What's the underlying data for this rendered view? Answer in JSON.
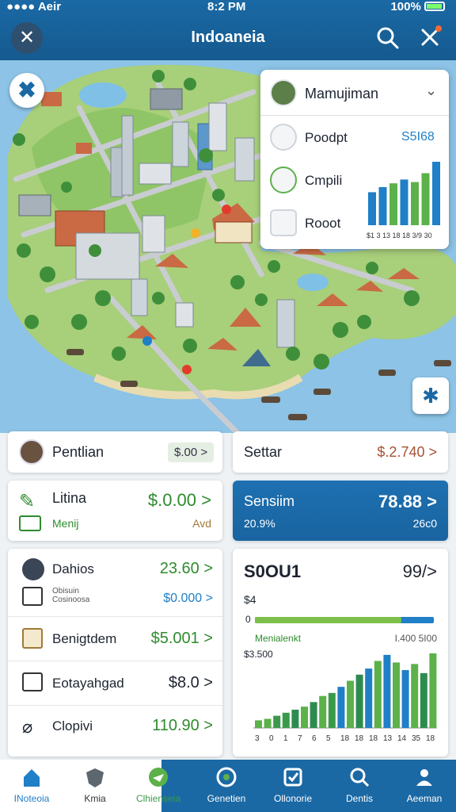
{
  "status_bar": {
    "carrier": "●●●● Aeir",
    "time": "8:2 PM",
    "battery": "100%"
  },
  "header": {
    "title": "Indoaneia",
    "close_icon": "close-icon",
    "search_icon": "search-icon",
    "tool_icon": "tools-icon"
  },
  "map": {
    "fab_icon": "compass-x-icon",
    "fab2_icon": "recenter-icon"
  },
  "overlay": {
    "title": "Mamujiman",
    "rows": [
      {
        "label": "Poodpt",
        "icon": "user-icon"
      },
      {
        "label": "Cmpili",
        "icon": "leaf-icon"
      },
      {
        "label": "Rooot",
        "icon": "house-icon"
      }
    ],
    "value": "S5I68",
    "chart_data": {
      "type": "bar",
      "categories": [
        "$1",
        "$3",
        "13",
        "18",
        "18",
        "3/9",
        "30"
      ],
      "series": [
        {
          "values": [
            52,
            60,
            66,
            72,
            68,
            82,
            100
          ],
          "colors": [
            "#1f7fc7",
            "#1f7fc7",
            "#5cb14a",
            "#1f7fc7",
            "#5cb14a",
            "#5cb14a",
            "#1f7fc7"
          ]
        }
      ],
      "tick_text": "$1 3 13 18 18 3/9 30"
    }
  },
  "cards": {
    "c1": {
      "label": "Pentlian",
      "value": "$.00 >"
    },
    "c2": {
      "label": "Settar",
      "value": "$.2.740 >"
    },
    "c3": {
      "label": "Litina",
      "sub": "Menij",
      "value": "$.0.00 >",
      "sub_value": "Avd"
    },
    "c4": {
      "label": "Sensiim",
      "sub": "20.9%",
      "value": "78.88 >",
      "sub_value": "26c0"
    },
    "c5": {
      "rows": [
        {
          "label": "Dahios",
          "value": "23.60 >",
          "value_color": "#2e8b2e"
        },
        {
          "label": "Obisuin Cosinoosa",
          "value": "$0.000 >",
          "value_color": "#1f7fc7"
        },
        {
          "label": "Benigtdem",
          "value": "$5.001 >",
          "value_color": "#2e8b2e"
        },
        {
          "label": "Eotayahgad",
          "value": "$8.0 >",
          "value_color": "#1d2430"
        },
        {
          "label": "Clopivi",
          "value": "110.90 >",
          "value_color": "#2e8b2e"
        }
      ]
    },
    "c6": {
      "title": "S0OU1",
      "value": "99/>",
      "small": "$4",
      "zero": "0",
      "line_label": "Menialenkt",
      "line_right": "I.400 5I00",
      "ylabel": "$3.500",
      "progress": 0.82,
      "chart_data": {
        "type": "bar",
        "x": [
          "3",
          "0",
          "1",
          "7",
          "6",
          "5",
          "18",
          "18",
          "18",
          "13",
          "14",
          "35",
          "18"
        ],
        "series": [
          {
            "values": [
              10,
              12,
              16,
              20,
              24,
              28,
              34,
              42,
              46,
              54,
              62,
              70,
              78,
              88,
              96,
              86,
              76,
              84,
              72,
              98
            ]
          }
        ],
        "colors": [
          "#5cb14a",
          "#5cb14a",
          "#3a9a4b",
          "#3a9a4b",
          "#2e8b50",
          "#5cb14a",
          "#2e8b50",
          "#5cb14a",
          "#3a9a4b",
          "#1f7fc7",
          "#5cb14a",
          "#2e8b50",
          "#1f7fc7",
          "#5cb14a",
          "#1f7fc7",
          "#5cb14a",
          "#1f7fc7",
          "#5cb14a",
          "#2e8b50",
          "#5cb14a"
        ]
      }
    }
  },
  "nav": [
    {
      "label": "INoteoia",
      "icon": "home-icon",
      "active": true
    },
    {
      "label": "Kmia",
      "icon": "shield-icon"
    },
    {
      "label": "Clhienseia",
      "icon": "plane-icon"
    },
    {
      "label": "Genetien",
      "icon": "target-icon"
    },
    {
      "label": "Ollonorie",
      "icon": "checkbox-icon"
    },
    {
      "label": "Dentis",
      "icon": "search-icon"
    },
    {
      "label": "Aeeman",
      "icon": "person-icon"
    }
  ]
}
